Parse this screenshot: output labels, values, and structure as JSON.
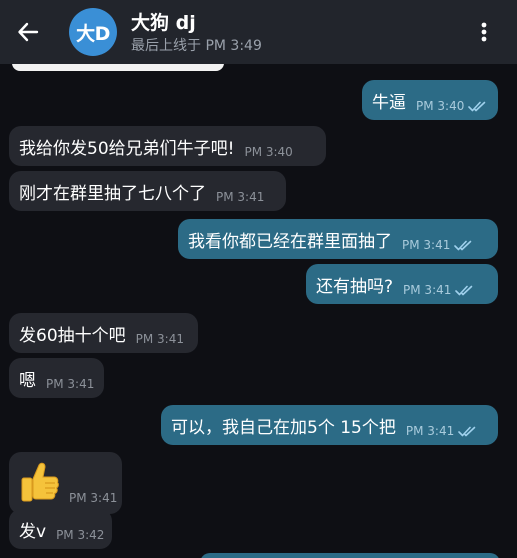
{
  "header": {
    "avatar_text": "大D",
    "name": "大狗 dj",
    "status": "最后上线于 PM 3:49"
  },
  "colors": {
    "header_bg": "#22252c",
    "chat_bg": "#0e0f14",
    "incoming_bubble": "#26282f",
    "outgoing_bubble": "#2c6b86",
    "avatar_bg": "#3a8fd6"
  },
  "messages": [
    {
      "dir": "out",
      "text": "牛逼",
      "time": "PM 3:40",
      "read": true
    },
    {
      "dir": "in",
      "text": "我给你发50给兄弟们牛子吧!",
      "time": "PM 3:40"
    },
    {
      "dir": "in",
      "text": "刚才在群里抽了七八个了",
      "time": "PM 3:41"
    },
    {
      "dir": "out",
      "text": "我看你都已经在群里面抽了",
      "time": "PM 3:41",
      "read": true
    },
    {
      "dir": "out",
      "text": "还有抽吗?",
      "time": "PM 3:41",
      "read": true
    },
    {
      "dir": "in",
      "text": "发60抽十个吧",
      "time": "PM 3:41"
    },
    {
      "dir": "in",
      "text": "嗯",
      "time": "PM 3:41"
    },
    {
      "dir": "out",
      "text": "可以，我自己在加5个 15个把",
      "time": "PM 3:41",
      "read": true
    },
    {
      "dir": "in",
      "emoji": "thumbs-up",
      "time": "PM 3:41"
    },
    {
      "dir": "in",
      "text": "发v",
      "time": "PM 3:42"
    }
  ]
}
